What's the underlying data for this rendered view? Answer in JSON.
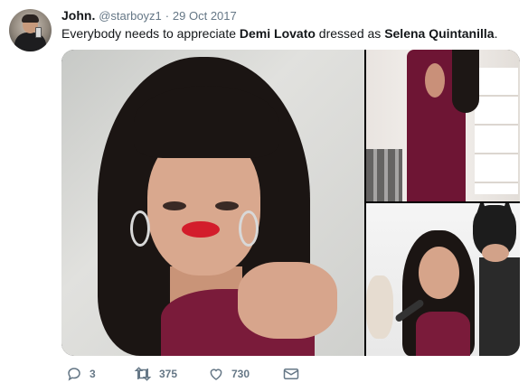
{
  "tweet": {
    "author_name": "John.",
    "handle": "@starboyz1",
    "separator": "·",
    "date": "29 Oct 2017",
    "text_parts": [
      {
        "text": "Everybody needs to appreciate ",
        "bold": false
      },
      {
        "text": "Demi Lovato",
        "bold": true
      },
      {
        "text": " dressed as ",
        "bold": false
      },
      {
        "text": "Selena Quintanilla",
        "bold": true
      },
      {
        "text": ".",
        "bold": false
      }
    ]
  },
  "actions": {
    "reply_count": "3",
    "retweet_count": "375",
    "like_count": "730"
  },
  "icons": {
    "reply": "reply-icon",
    "retweet": "retweet-icon",
    "like": "heart-icon",
    "dm": "envelope-icon"
  },
  "colors": {
    "text": "#14171a",
    "muted": "#657786"
  }
}
